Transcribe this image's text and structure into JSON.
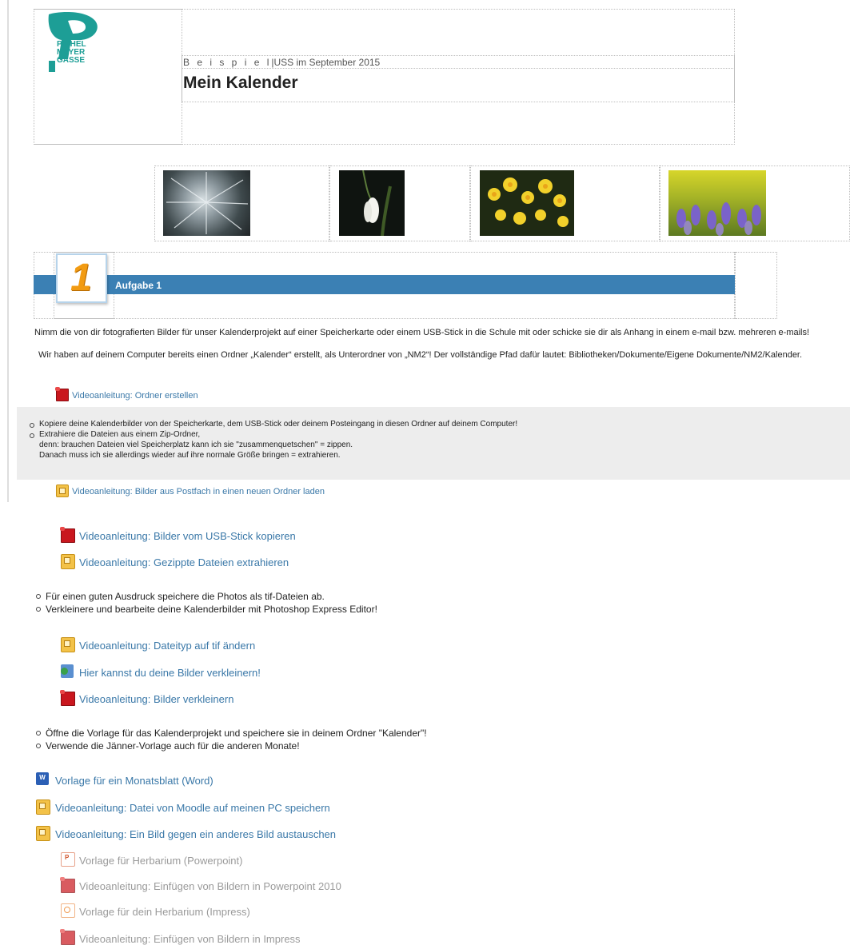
{
  "logo": {
    "line1": "PICHEL",
    "line2": "MAYER",
    "line3": "GASSE"
  },
  "header": {
    "subtitle_spaced": "B e i s p i e l",
    "subtitle_rest": "|USS im September 2015",
    "title": "Mein Kalender"
  },
  "photos": [
    "Kiefernzweig mit Frost",
    "Schneeglöckchen",
    "Narzissen",
    "Traubenhyazinthen"
  ],
  "task": {
    "number": "1",
    "label": "Aufgabe 1"
  },
  "intro": {
    "line1": "Nimm die von dir fotografierten Bilder für unser Kalenderprojekt auf einer Speicherkarte oder einem USB-Stick in die Schule mit oder schicke sie dir als Anhang in einem e-mail bzw. mehreren e-mails!",
    "line2": "Wir haben auf deinem Computer bereits einen Ordner „Kalender“ erstellt, als Unterordner von „NM2“! Der vollständige Pfad dafür lautet: Bibliotheken/Dokumente/Eigene Dokumente/NM2/Kalender."
  },
  "links": {
    "ordner": "Videoanleitung: Ordner erstellen",
    "postfach": "Videoanleitung: Bilder aus Postfach in einen neuen Ordner laden",
    "usb": "Videoanleitung: Bilder vom USB-Stick kopieren",
    "zip": "Videoanleitung: Gezippte Dateien extrahieren",
    "tif": "Videoanleitung: Dateityp auf tif ändern",
    "verkleinern_web": "Hier kannst du deine Bilder verkleinern!",
    "verkleinern": "Videoanleitung: Bilder verkleinern",
    "word": "Vorlage für ein Monatsblatt (Word)",
    "moodle": "Videoanleitung: Datei von Moodle auf meinen PC speichern",
    "austauschen": "Videoanleitung: Ein Bild gegen ein anderes Bild austauschen",
    "herbarium_ppt": "Vorlage für Herbarium (Powerpoint)",
    "einfuegen_ppt": "Videoanleitung: Einfügen von Bildern in Powerpoint 2010",
    "herbarium_imp": "Vorlage für dein Herbarium (Impress)",
    "einfuegen_imp": "Videoanleitung: Einfügen von Bildern in Impress"
  },
  "grey_box": {
    "bullet1": "Kopiere deine Kalenderbilder von der Speicherkarte, dem USB-Stick oder deinem Posteingang in diesen Ordner auf deinem Computer!",
    "bullet2_l1": "Extrahiere die Dateien aus einem Zip-Ordner,",
    "bullet2_l2": "denn: brauchen Dateien viel Speicherplatz kann ich sie \"zusammenquetschen\" = zippen.",
    "bullet2_l3": "Danach muss ich sie allerdings wieder auf ihre normale Größe bringen = extrahieren."
  },
  "bullets2": [
    "Für einen guten Ausdruck speichere die Photos als tif-Dateien ab.",
    "Verkleinere und bearbeite deine Kalenderbilder mit Photoshop Express Editor!"
  ],
  "bullets3": [
    "Öffne die Vorlage für das Kalenderprojekt und speichere sie in deinem Ordner \"Kalender\"!",
    "Verwende die Jänner-Vorlage auch für die anderen Monate!"
  ],
  "icons": {
    "word": "W"
  }
}
